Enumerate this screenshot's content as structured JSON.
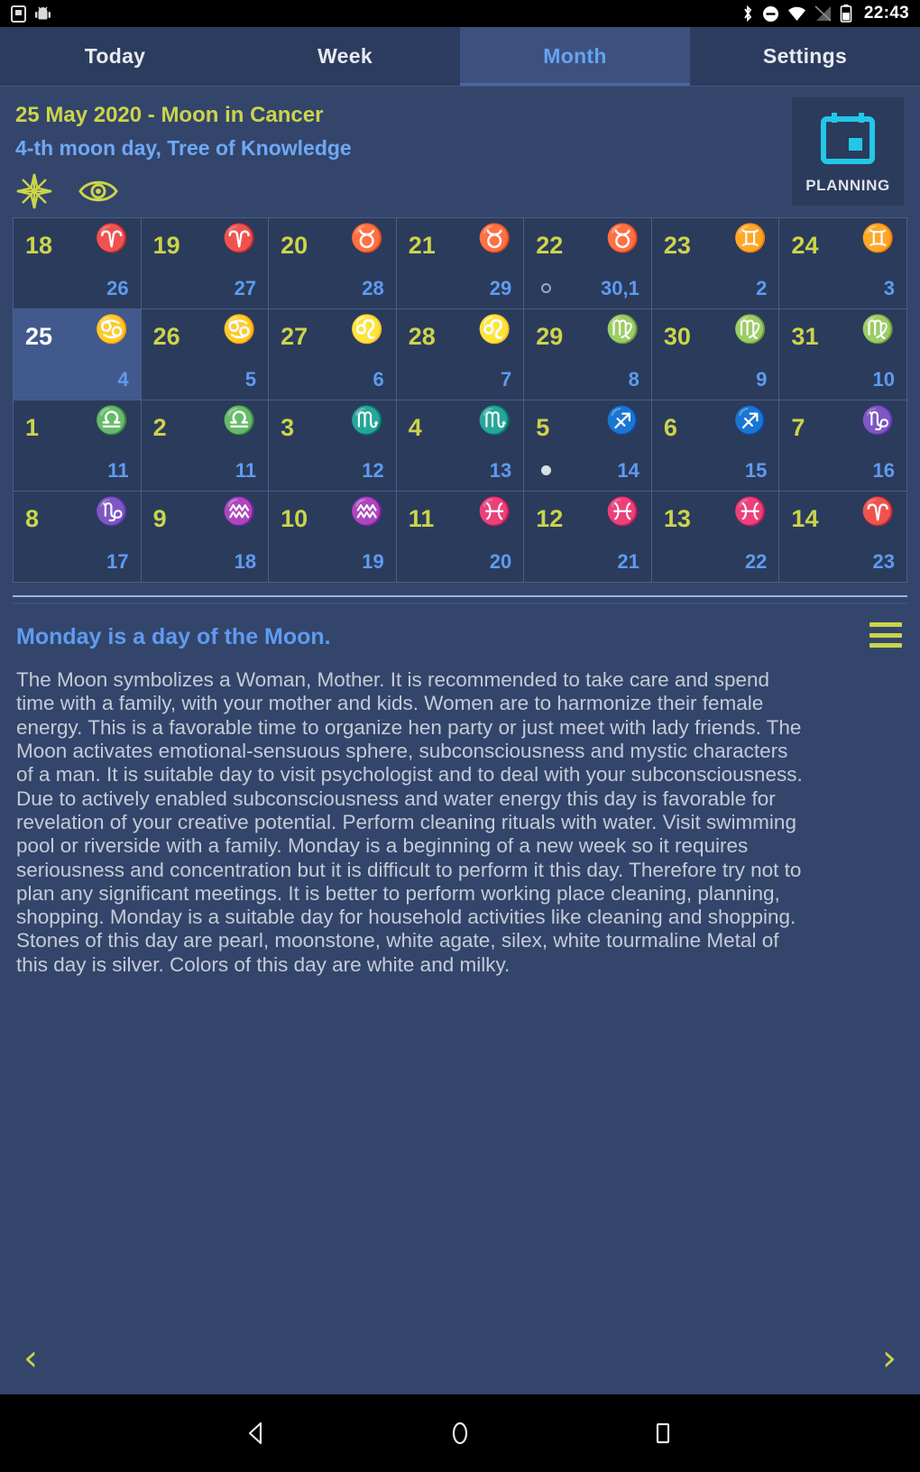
{
  "statusbar": {
    "clock": "22:43",
    "left_icons": [
      "sdcard-icon",
      "android-robot-icon"
    ],
    "right_icons": [
      "bluetooth-icon",
      "dnd-icon",
      "wifi-icon",
      "signal-off-icon",
      "battery-icon"
    ]
  },
  "tabs": [
    {
      "label": "Today",
      "active": false
    },
    {
      "label": "Week",
      "active": false
    },
    {
      "label": "Month",
      "active": true
    },
    {
      "label": "Settings",
      "active": false
    }
  ],
  "header": {
    "title": "25 May 2020 - Moon in Cancer",
    "subtitle": "4-th moon day, Tree of Knowledge",
    "icons": [
      "eight-pointed-star-icon",
      "eye-icon"
    ],
    "planning_button": {
      "label": "PLANNING",
      "icon": "calendar-icon"
    }
  },
  "colors": {
    "page_bg": "#33456b",
    "cell_bg": "#2b3b5c",
    "cell_selected_bg": "#41598c",
    "day_number": "#ccd44a",
    "moon_day": "#5f9bf0",
    "zodiac": "#c3c9d4",
    "accent_cyan": "#22c8e8",
    "tab_active_text": "#64a4f0",
    "body_text": "#c5cbd6"
  },
  "calendar": {
    "cells": [
      {
        "day": "18",
        "zodiac": "♈",
        "zodiac_name": "aries",
        "moon_day": "26",
        "phase": "",
        "selected": false
      },
      {
        "day": "19",
        "zodiac": "♈",
        "zodiac_name": "aries",
        "moon_day": "27",
        "phase": "",
        "selected": false
      },
      {
        "day": "20",
        "zodiac": "♉",
        "zodiac_name": "taurus",
        "moon_day": "28",
        "phase": "",
        "selected": false
      },
      {
        "day": "21",
        "zodiac": "♉",
        "zodiac_name": "taurus",
        "moon_day": "29",
        "phase": "",
        "selected": false
      },
      {
        "day": "22",
        "zodiac": "♉",
        "zodiac_name": "taurus",
        "moon_day": "30,1",
        "phase": "new",
        "selected": false
      },
      {
        "day": "23",
        "zodiac": "♊",
        "zodiac_name": "gemini",
        "moon_day": "2",
        "phase": "",
        "selected": false
      },
      {
        "day": "24",
        "zodiac": "♊",
        "zodiac_name": "gemini",
        "moon_day": "3",
        "phase": "",
        "selected": false
      },
      {
        "day": "25",
        "zodiac": "♋",
        "zodiac_name": "cancer",
        "moon_day": "4",
        "phase": "",
        "selected": true
      },
      {
        "day": "26",
        "zodiac": "♋",
        "zodiac_name": "cancer",
        "moon_day": "5",
        "phase": "",
        "selected": false
      },
      {
        "day": "27",
        "zodiac": "♌",
        "zodiac_name": "leo",
        "moon_day": "6",
        "phase": "",
        "selected": false
      },
      {
        "day": "28",
        "zodiac": "♌",
        "zodiac_name": "leo",
        "moon_day": "7",
        "phase": "",
        "selected": false
      },
      {
        "day": "29",
        "zodiac": "♍",
        "zodiac_name": "virgo",
        "moon_day": "8",
        "phase": "",
        "selected": false
      },
      {
        "day": "30",
        "zodiac": "♍",
        "zodiac_name": "virgo",
        "moon_day": "9",
        "phase": "",
        "selected": false
      },
      {
        "day": "31",
        "zodiac": "♍",
        "zodiac_name": "virgo",
        "moon_day": "10",
        "phase": "",
        "selected": false
      },
      {
        "day": "1",
        "zodiac": "♎",
        "zodiac_name": "libra",
        "moon_day": "11",
        "phase": "",
        "selected": false
      },
      {
        "day": "2",
        "zodiac": "♎",
        "zodiac_name": "libra",
        "moon_day": "11",
        "phase": "",
        "selected": false
      },
      {
        "day": "3",
        "zodiac": "♏",
        "zodiac_name": "scorpio",
        "moon_day": "12",
        "phase": "",
        "selected": false
      },
      {
        "day": "4",
        "zodiac": "♏",
        "zodiac_name": "scorpio",
        "moon_day": "13",
        "phase": "",
        "selected": false
      },
      {
        "day": "5",
        "zodiac": "♐",
        "zodiac_name": "sagittarius",
        "moon_day": "14",
        "phase": "full",
        "selected": false
      },
      {
        "day": "6",
        "zodiac": "♐",
        "zodiac_name": "sagittarius",
        "moon_day": "15",
        "phase": "",
        "selected": false
      },
      {
        "day": "7",
        "zodiac": "♑",
        "zodiac_name": "capricorn",
        "moon_day": "16",
        "phase": "",
        "selected": false
      },
      {
        "day": "8",
        "zodiac": "♑",
        "zodiac_name": "capricorn",
        "moon_day": "17",
        "phase": "",
        "selected": false
      },
      {
        "day": "9",
        "zodiac": "♒",
        "zodiac_name": "aquarius",
        "moon_day": "18",
        "phase": "",
        "selected": false
      },
      {
        "day": "10",
        "zodiac": "♒",
        "zodiac_name": "aquarius",
        "moon_day": "19",
        "phase": "",
        "selected": false
      },
      {
        "day": "11",
        "zodiac": "♓",
        "zodiac_name": "pisces",
        "moon_day": "20",
        "phase": "",
        "selected": false
      },
      {
        "day": "12",
        "zodiac": "♓",
        "zodiac_name": "pisces",
        "moon_day": "21",
        "phase": "",
        "selected": false
      },
      {
        "day": "13",
        "zodiac": "♓",
        "zodiac_name": "pisces",
        "moon_day": "22",
        "phase": "",
        "selected": false
      },
      {
        "day": "14",
        "zodiac": "♈",
        "zodiac_name": "aries",
        "moon_day": "23",
        "phase": "",
        "selected": false
      }
    ]
  },
  "description": {
    "title": "Monday is a day of the Moon.",
    "menu_icon": "hamburger-icon",
    "body": "The Moon symbolizes a Woman, Mother. It is recommended to take care and spend time with a family, with your mother and kids. Women are to harmonize their female energy. This is a favorable time to organize hen party or just meet with lady friends. The Moon activates emotional-sensuous sphere, subconsciousness and mystic characters of a man. It is suitable day to visit psychologist and to deal with your subconsciousness. Due to actively enabled subconsciousness and water energy this day is favorable for revelation of your creative potential. Perform cleaning rituals with water. Visit swimming pool or riverside with a family. Monday is a beginning of a new week so it requires seriousness and concentration but it is difficult to perform it this day. Therefore try not to plan any significant meetings. It is better to perform working place cleaning, planning, shopping. Monday is a suitable day for household activities like cleaning and shopping. Stones of this day are pearl, moonstone, white agate, silex, white tourmaline Metal of this day is silver. Colors of this day are white and milky."
  },
  "pager": {
    "prev_label": "‹",
    "next_label": "›"
  },
  "navbar": {
    "buttons": [
      "back-icon",
      "home-icon",
      "recents-icon"
    ]
  }
}
